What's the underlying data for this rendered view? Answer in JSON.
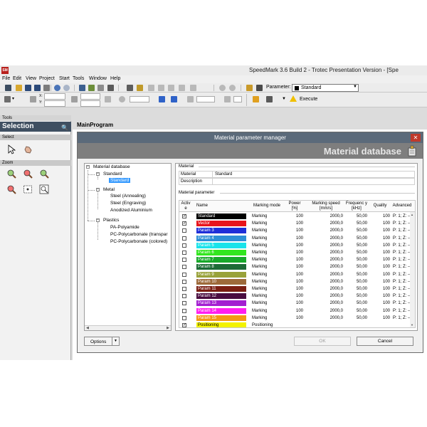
{
  "window": {
    "icon_text": "SM",
    "title": "SpeedMark 3.6 Build 2 - Trotec Presentation Version - [Spe"
  },
  "menu": [
    "File",
    "Edit",
    "View",
    "Project",
    "Start",
    "Tools",
    "Window",
    "Help"
  ],
  "toolbar": {
    "parameter_label": "Parameter:",
    "parameter_value": "Standard",
    "execute_label": "Execute",
    "coord_x_label": "X:",
    "coord_y_label": "Y:"
  },
  "tools_panel": {
    "header": "Tools",
    "title": "Selection",
    "selection_section": "Select",
    "zoom_section": "Zoom"
  },
  "main": {
    "title": "MainProgram"
  },
  "dialog": {
    "title": "Material parameter manager",
    "banner": "Material database",
    "tree": {
      "root": "Material database",
      "groups": [
        {
          "label": "Standard",
          "children": [
            "Standard"
          ]
        },
        {
          "label": "Metal",
          "children": [
            "Steel (Annealing)",
            "Steel (Engraving)",
            "Anodized Aluminium"
          ]
        },
        {
          "label": "Plastics",
          "children": [
            "PA-Polyamide",
            "PC-Polycarbonate (transpar",
            "PC-Polycarbonate (colored)"
          ]
        }
      ]
    },
    "material": {
      "group_label": "Material",
      "material_label": "Material",
      "material_value": "Standard",
      "description_label": "Description",
      "description_value": ""
    },
    "parameters": {
      "group_label": "Material parameter",
      "columns": {
        "active": "Activ e",
        "name": "Name",
        "mode": "Marking mode",
        "power": "Power [%]",
        "speed": "Marking speed [mm/s]",
        "freq": "Frequenc y [kHz]",
        "quality": "Quality",
        "advanced": "Advanced"
      },
      "rows": [
        {
          "active": true,
          "name": "Standard",
          "bg": "#000000",
          "fg": "#ffffff",
          "mode": "Marking",
          "power": "100",
          "speed": "2000,0",
          "freq": "50,00",
          "quality": "100",
          "advanced": "P: 1; Z: ---;"
        },
        {
          "active": true,
          "name": "Vector",
          "bg": "#e8141c",
          "fg": "#ffffff",
          "mode": "Marking",
          "power": "100",
          "speed": "2000,0",
          "freq": "50,00",
          "quality": "100",
          "advanced": "P: 1; Z: ---;"
        },
        {
          "active": false,
          "name": "Param 3",
          "bg": "#1f2fd8",
          "fg": "#ffffff",
          "mode": "Marking",
          "power": "100",
          "speed": "2000,0",
          "freq": "50,00",
          "quality": "100",
          "advanced": "P: 1; Z: ---;"
        },
        {
          "active": false,
          "name": "Param 4",
          "bg": "#2e8fd6",
          "fg": "#ffffff",
          "mode": "Marking",
          "power": "100",
          "speed": "2000,0",
          "freq": "50,00",
          "quality": "100",
          "advanced": "P: 1; Z: ---;"
        },
        {
          "active": false,
          "name": "Param 5",
          "bg": "#19e3ea",
          "fg": "#ffffff",
          "mode": "Marking",
          "power": "100",
          "speed": "2000,0",
          "freq": "50,00",
          "quality": "100",
          "advanced": "P: 1; Z: ---;"
        },
        {
          "active": false,
          "name": "Param 6",
          "bg": "#32e61f",
          "fg": "#ffffff",
          "mode": "Marking",
          "power": "100",
          "speed": "2000,0",
          "freq": "50,00",
          "quality": "100",
          "advanced": "P: 1; Z: ---;"
        },
        {
          "active": false,
          "name": "Param 7",
          "bg": "#18a92a",
          "fg": "#ffffff",
          "mode": "Marking",
          "power": "100",
          "speed": "2000,0",
          "freq": "50,00",
          "quality": "100",
          "advanced": "P: 1; Z: ---;"
        },
        {
          "active": false,
          "name": "Param 8",
          "bg": "#1d6b36",
          "fg": "#ffffff",
          "mode": "Marking",
          "power": "100",
          "speed": "2000,0",
          "freq": "50,00",
          "quality": "100",
          "advanced": "P: 1; Z: ---;"
        },
        {
          "active": false,
          "name": "Param 9",
          "bg": "#99a23a",
          "fg": "#ffffff",
          "mode": "Marking",
          "power": "100",
          "speed": "2000,0",
          "freq": "50,00",
          "quality": "100",
          "advanced": "P: 1; Z: ---;"
        },
        {
          "active": false,
          "name": "Param 10",
          "bg": "#9d6a3a",
          "fg": "#ffffff",
          "mode": "Marking",
          "power": "100",
          "speed": "2000,0",
          "freq": "50,00",
          "quality": "100",
          "advanced": "P: 1; Z: ---;"
        },
        {
          "active": false,
          "name": "Param 11",
          "bg": "#7a1e12",
          "fg": "#ffffff",
          "mode": "Marking",
          "power": "100",
          "speed": "2000,0",
          "freq": "50,00",
          "quality": "100",
          "advanced": "P: 1; Z: ---;"
        },
        {
          "active": false,
          "name": "Param 12",
          "bg": "#4a0c40",
          "fg": "#ffffff",
          "mode": "Marking",
          "power": "100",
          "speed": "2000,0",
          "freq": "50,00",
          "quality": "100",
          "advanced": "P: 1; Z: ---;"
        },
        {
          "active": false,
          "name": "Param 13",
          "bg": "#a31fd1",
          "fg": "#ffffff",
          "mode": "Marking",
          "power": "100",
          "speed": "2000,0",
          "freq": "50,00",
          "quality": "100",
          "advanced": "P: 1; Z: ---;"
        },
        {
          "active": false,
          "name": "Param 14",
          "bg": "#ff1ff0",
          "fg": "#ffffff",
          "mode": "Marking",
          "power": "100",
          "speed": "2000,0",
          "freq": "50,00",
          "quality": "100",
          "advanced": "P: 1; Z: ---;"
        },
        {
          "active": false,
          "name": "Param 15",
          "bg": "#f39a14",
          "fg": "#ffffff",
          "mode": "Marking",
          "power": "100",
          "speed": "2000,0",
          "freq": "50,00",
          "quality": "100",
          "advanced": "P: 1; Z: ---;"
        },
        {
          "active": true,
          "name": "Positioning",
          "bg": "#f3f300",
          "fg": "#000000",
          "mode": "Positioning",
          "power": "",
          "speed": "",
          "freq": "",
          "quality": "",
          "advanced": ""
        }
      ]
    },
    "buttons": {
      "options": "Options",
      "ok": "OK",
      "cancel": "Cancel"
    }
  }
}
